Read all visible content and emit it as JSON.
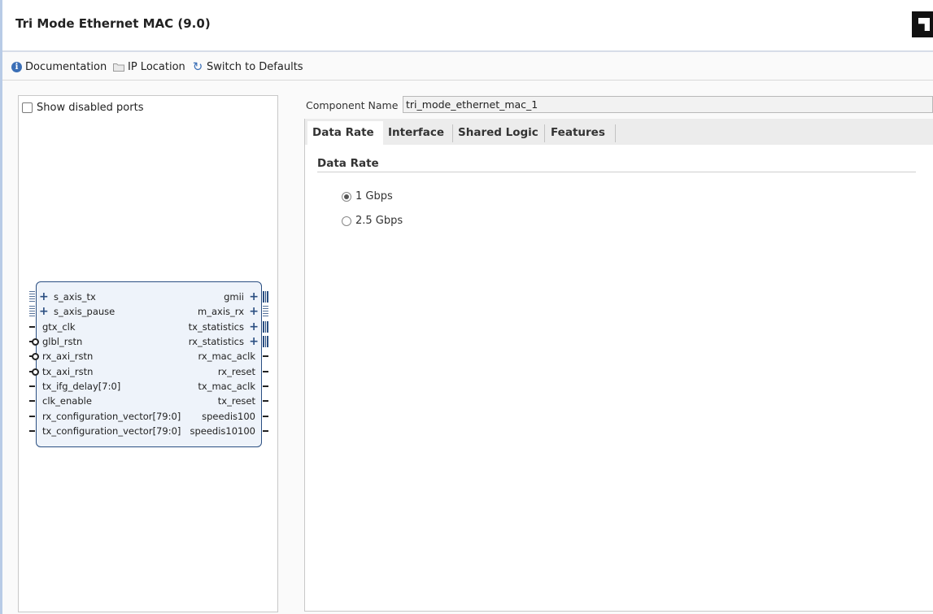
{
  "header": {
    "title": "Tri Mode Ethernet MAC (9.0)"
  },
  "toolbar": {
    "documentation": "Documentation",
    "ip_location": "IP Location",
    "switch_to_defaults": "Switch to Defaults"
  },
  "left_panel": {
    "show_disabled_ports": "Show disabled ports",
    "show_disabled_checked": false
  },
  "symbol": {
    "left_ports": [
      {
        "name": "s_axis_tx",
        "kind": "bus"
      },
      {
        "name": "s_axis_pause",
        "kind": "bus"
      },
      {
        "name": "gtx_clk",
        "kind": "pin"
      },
      {
        "name": "glbl_rstn",
        "kind": "active-low"
      },
      {
        "name": "rx_axi_rstn",
        "kind": "active-low"
      },
      {
        "name": "tx_axi_rstn",
        "kind": "active-low"
      },
      {
        "name": "tx_ifg_delay[7:0]",
        "kind": "pin"
      },
      {
        "name": "clk_enable",
        "kind": "pin"
      },
      {
        "name": "rx_configuration_vector[79:0]",
        "kind": "pin"
      },
      {
        "name": "tx_configuration_vector[79:0]",
        "kind": "pin"
      }
    ],
    "right_ports": [
      {
        "name": "gmii",
        "kind": "bus-solid"
      },
      {
        "name": "m_axis_rx",
        "kind": "bus-dotted"
      },
      {
        "name": "tx_statistics",
        "kind": "bus-solid"
      },
      {
        "name": "rx_statistics",
        "kind": "bus-solid"
      },
      {
        "name": "rx_mac_aclk",
        "kind": "pin"
      },
      {
        "name": "rx_reset",
        "kind": "pin"
      },
      {
        "name": "tx_mac_aclk",
        "kind": "pin"
      },
      {
        "name": "tx_reset",
        "kind": "pin"
      },
      {
        "name": "speedis100",
        "kind": "pin"
      },
      {
        "name": "speedis10100",
        "kind": "pin"
      }
    ]
  },
  "component": {
    "label": "Component Name",
    "value": "tri_mode_ethernet_mac_1"
  },
  "tabs": [
    {
      "label": "Data Rate",
      "active": true
    },
    {
      "label": "Interface",
      "active": false
    },
    {
      "label": "Shared Logic",
      "active": false
    },
    {
      "label": "Features",
      "active": false
    }
  ],
  "data_rate": {
    "section_title": "Data Rate",
    "options": [
      {
        "label": "1 Gbps",
        "selected": true
      },
      {
        "label": "2.5 Gbps",
        "selected": false
      }
    ]
  },
  "colors": {
    "accent": "#3b6fb6",
    "symbol_border": "#2b4f82",
    "symbol_fill": "#eef3fa"
  },
  "icons": {
    "documentation": "info-icon",
    "ip_location": "folder-icon",
    "switch_to_defaults": "refresh-icon",
    "brand": "vendor-logo"
  }
}
